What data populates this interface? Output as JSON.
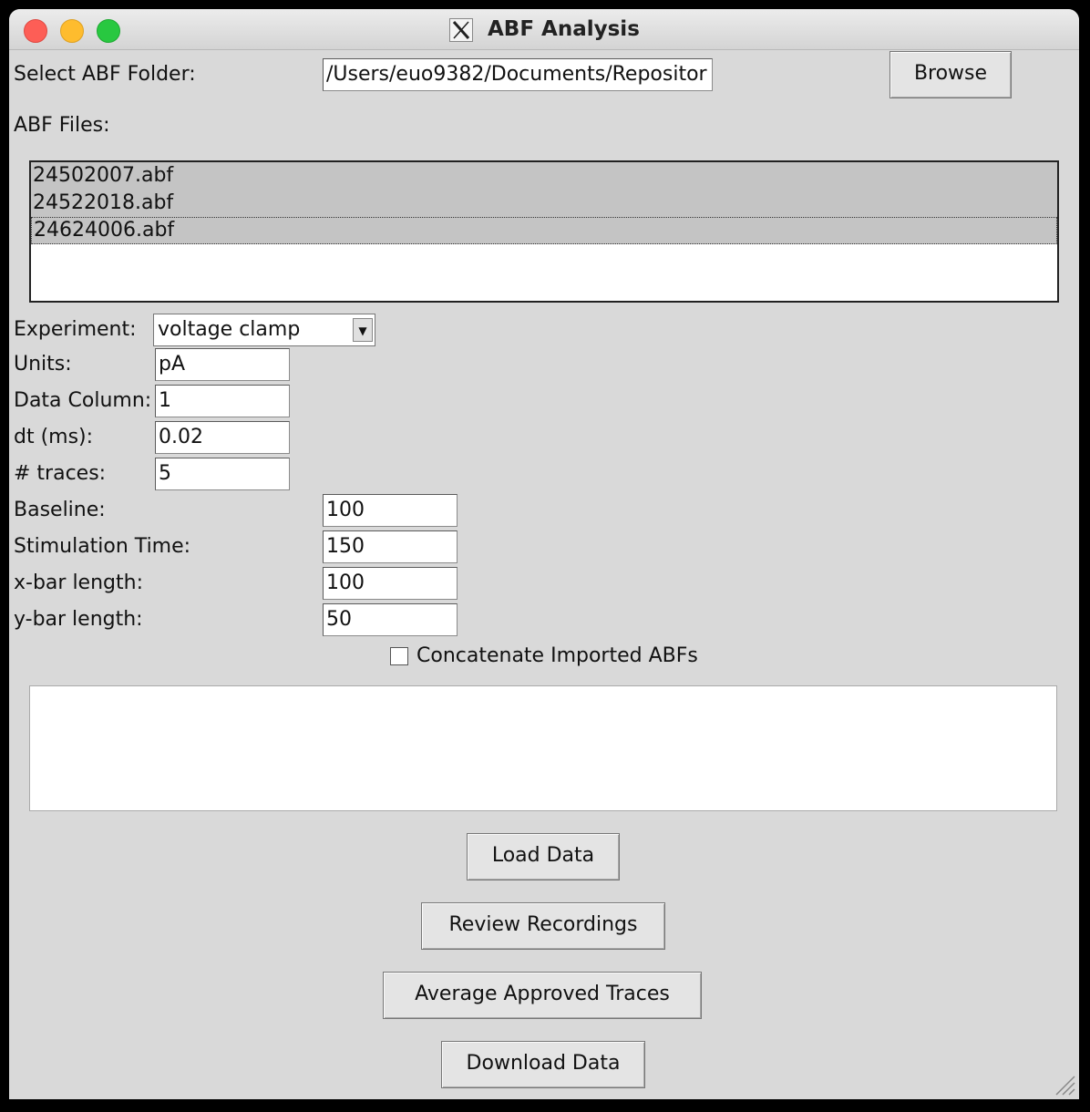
{
  "window": {
    "title": "ABF Analysis"
  },
  "folder": {
    "label": "Select ABF Folder:",
    "value": "/Users/euo9382/Documents/Repositor",
    "browse_label": "Browse"
  },
  "files": {
    "label": "ABF Files:",
    "items": [
      {
        "name": "24502007.abf",
        "selected": true
      },
      {
        "name": "24522018.abf",
        "selected": true
      },
      {
        "name": "24624006.abf",
        "selected": true
      }
    ]
  },
  "experiment": {
    "label": "Experiment:",
    "value": "voltage clamp"
  },
  "units": {
    "label": "Units:",
    "value": "pA"
  },
  "data_column": {
    "label": "Data Column:",
    "value": "1"
  },
  "dt": {
    "label": "dt (ms):",
    "value": "0.02"
  },
  "traces": {
    "label": "# traces:",
    "value": "5"
  },
  "baseline": {
    "label": "Baseline:",
    "value": "100"
  },
  "stim_time": {
    "label": "Stimulation Time:",
    "value": "150"
  },
  "xbar": {
    "label": "x-bar length:",
    "value": "100"
  },
  "ybar": {
    "label": "y-bar length:",
    "value": "50"
  },
  "concatenate": {
    "label": "Concatenate Imported ABFs",
    "checked": false
  },
  "output": {
    "text": ""
  },
  "buttons": {
    "load": "Load Data",
    "review": "Review Recordings",
    "average": "Average Approved Traces",
    "download": "Download Data"
  }
}
